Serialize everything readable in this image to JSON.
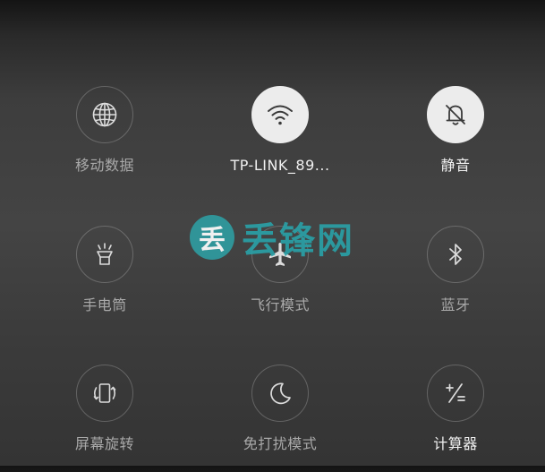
{
  "tiles": [
    {
      "label": "移动数据",
      "icon": "globe-icon",
      "active": false
    },
    {
      "label": "TP-LINK_89...",
      "icon": "wifi-icon",
      "active": true
    },
    {
      "label": "静音",
      "icon": "bell-off-icon",
      "active": true
    },
    {
      "label": "手电筒",
      "icon": "flashlight-icon",
      "active": false
    },
    {
      "label": "飞行模式",
      "icon": "airplane-icon",
      "active": false
    },
    {
      "label": "蓝牙",
      "icon": "bluetooth-icon",
      "active": false
    },
    {
      "label": "屏幕旋转",
      "icon": "screen-rotation-icon",
      "active": false
    },
    {
      "label": "免打扰模式",
      "icon": "moon-icon",
      "active": false
    },
    {
      "label": "计算器",
      "icon": "calculator-icon",
      "active": false
    }
  ],
  "watermark": {
    "badge": "丢",
    "text": "丢锋网"
  },
  "colors": {
    "active_fill": "#ececec",
    "label": "#a9a9a9",
    "active_label": "#f0f0f0",
    "watermark": "#2aa0a6"
  }
}
